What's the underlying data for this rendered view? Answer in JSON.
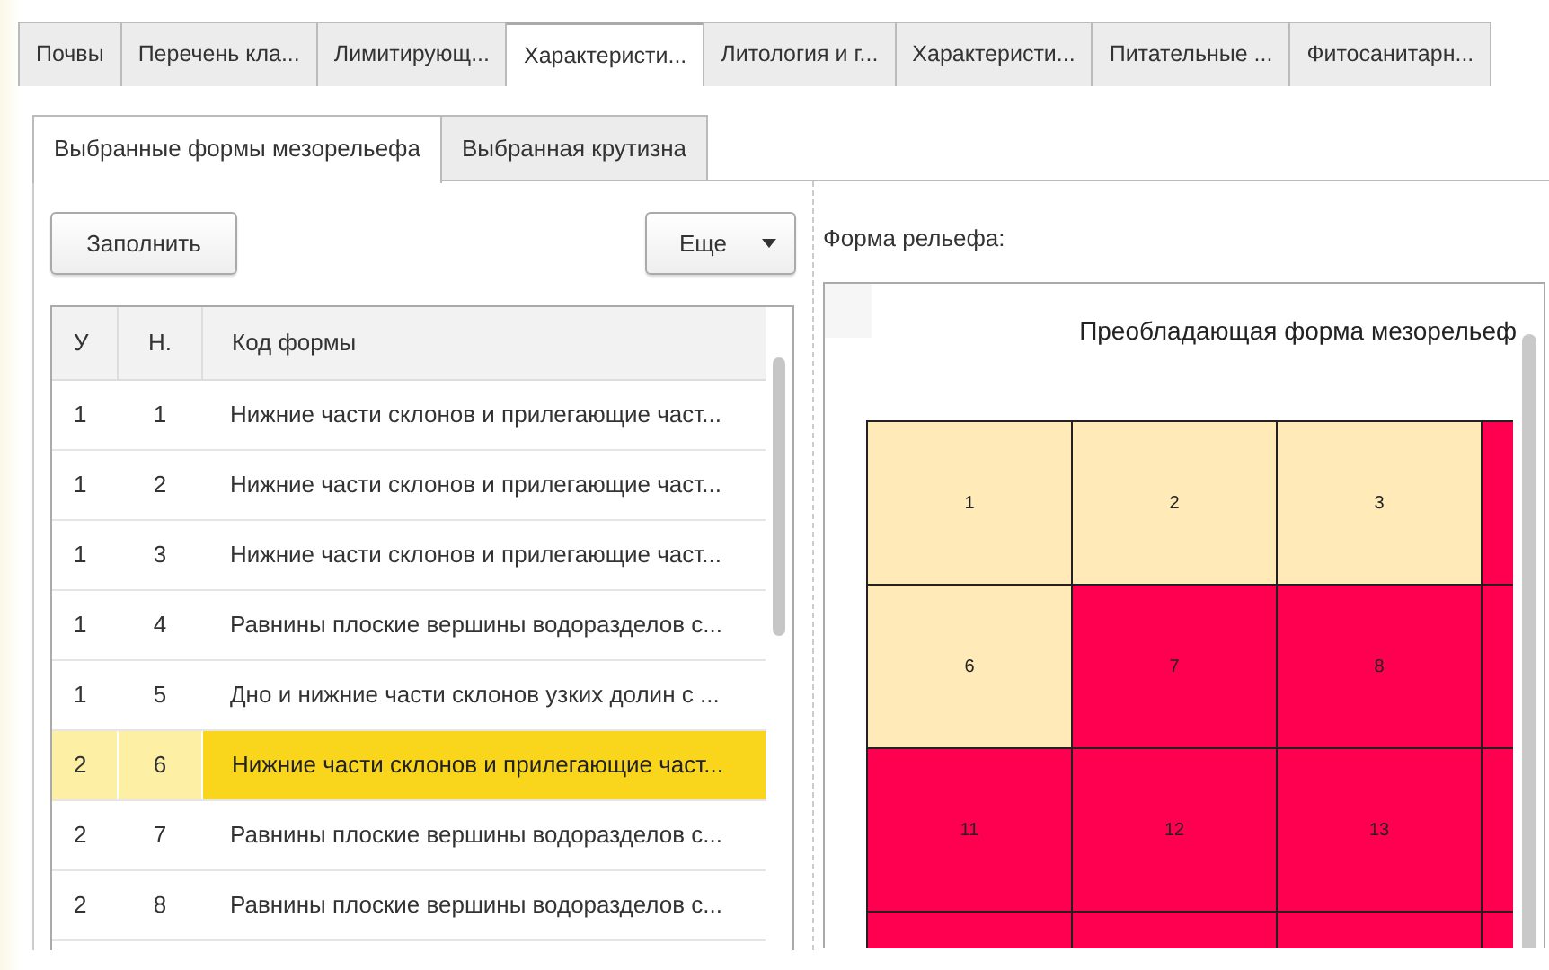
{
  "tabs": [
    {
      "label": "Почвы",
      "selected": false
    },
    {
      "label": "Перечень кла...",
      "selected": false
    },
    {
      "label": "Лимитирующ...",
      "selected": false
    },
    {
      "label": "Характеристи...",
      "selected": true
    },
    {
      "label": "Литология и г...",
      "selected": false
    },
    {
      "label": "Характеристи...",
      "selected": false
    },
    {
      "label": "Питательные ...",
      "selected": false
    },
    {
      "label": "Фитосанитарн...",
      "selected": false
    }
  ],
  "subtabs": [
    {
      "label": "Выбранные формы мезорельефа",
      "selected": true
    },
    {
      "label": "Выбранная крутизна",
      "selected": false
    }
  ],
  "toolbar": {
    "fill_button": "Заполнить",
    "more_button": "Еще"
  },
  "table": {
    "columns": [
      "У",
      "Н.",
      "Код формы"
    ],
    "rows": [
      {
        "u": "1",
        "n": "1",
        "code": "Нижние части склонов и прилегающие част...",
        "selected": false
      },
      {
        "u": "1",
        "n": "2",
        "code": "Нижние части склонов и прилегающие част...",
        "selected": false
      },
      {
        "u": "1",
        "n": "3",
        "code": "Нижние части склонов и прилегающие част...",
        "selected": false
      },
      {
        "u": "1",
        "n": "4",
        "code": "Равнины плоские вершины водоразделов с...",
        "selected": false
      },
      {
        "u": "1",
        "n": "5",
        "code": "Дно и нижние части склонов узких долин с ...",
        "selected": false
      },
      {
        "u": "2",
        "n": "6",
        "code": "Нижние части склонов и прилегающие част...",
        "selected": true
      },
      {
        "u": "2",
        "n": "7",
        "code": "Равнины плоские вершины водоразделов с...",
        "selected": false
      },
      {
        "u": "2",
        "n": "8",
        "code": "Равнины плоские вершины водоразделов с...",
        "selected": false
      }
    ]
  },
  "relief": {
    "label": "Форма рельефа:",
    "title": "Преобладающая форма мезорельеф",
    "cells": [
      {
        "label": "1",
        "color": "#ffeab8"
      },
      {
        "label": "2",
        "color": "#ffeab8"
      },
      {
        "label": "3",
        "color": "#ffeab8"
      },
      {
        "color": "#ff0050"
      },
      {
        "label": "6",
        "color": "#ffeab8"
      },
      {
        "label": "7",
        "color": "#ff0050"
      },
      {
        "label": "8",
        "color": "#ff0050"
      },
      {
        "color": "#ff0050"
      },
      {
        "label": "11",
        "color": "#ff0050"
      },
      {
        "label": "12",
        "color": "#ff0050"
      },
      {
        "label": "13",
        "color": "#ff0050"
      },
      {
        "color": "#ff0050"
      },
      {
        "color": "#ff0050"
      },
      {
        "color": "#ff0050"
      },
      {
        "color": "#ff0050"
      },
      {
        "color": "#ff0050"
      }
    ]
  }
}
